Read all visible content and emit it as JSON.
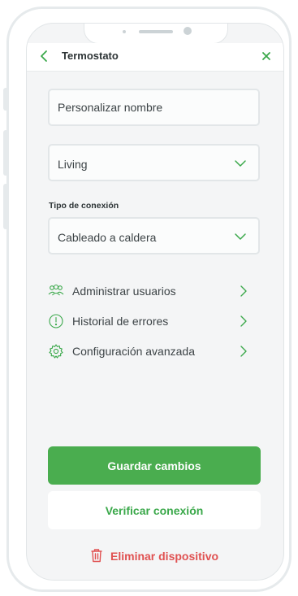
{
  "header": {
    "title": "Termostato",
    "back_icon": "chevron-left-icon",
    "close_icon": "close-icon"
  },
  "form": {
    "name_field": {
      "placeholder": "Personalizar nombre",
      "value": ""
    },
    "room_select": {
      "value": "Living"
    },
    "connection_type": {
      "label": "Tipo de conexión",
      "value": "Cableado a caldera"
    }
  },
  "menu": [
    {
      "label": "Administrar usuarios",
      "icon": "users-icon"
    },
    {
      "label": "Historial de errores",
      "icon": "alert-circle-icon"
    },
    {
      "label": "Configuración avanzada",
      "icon": "gear-icon"
    }
  ],
  "actions": {
    "save_label": "Guardar cambios",
    "verify_label": "Verificar conexión",
    "delete_label": "Eliminar dispositivo"
  },
  "colors": {
    "accent": "#4aad4f",
    "danger": "#e05151",
    "background": "#f4f5f6"
  }
}
